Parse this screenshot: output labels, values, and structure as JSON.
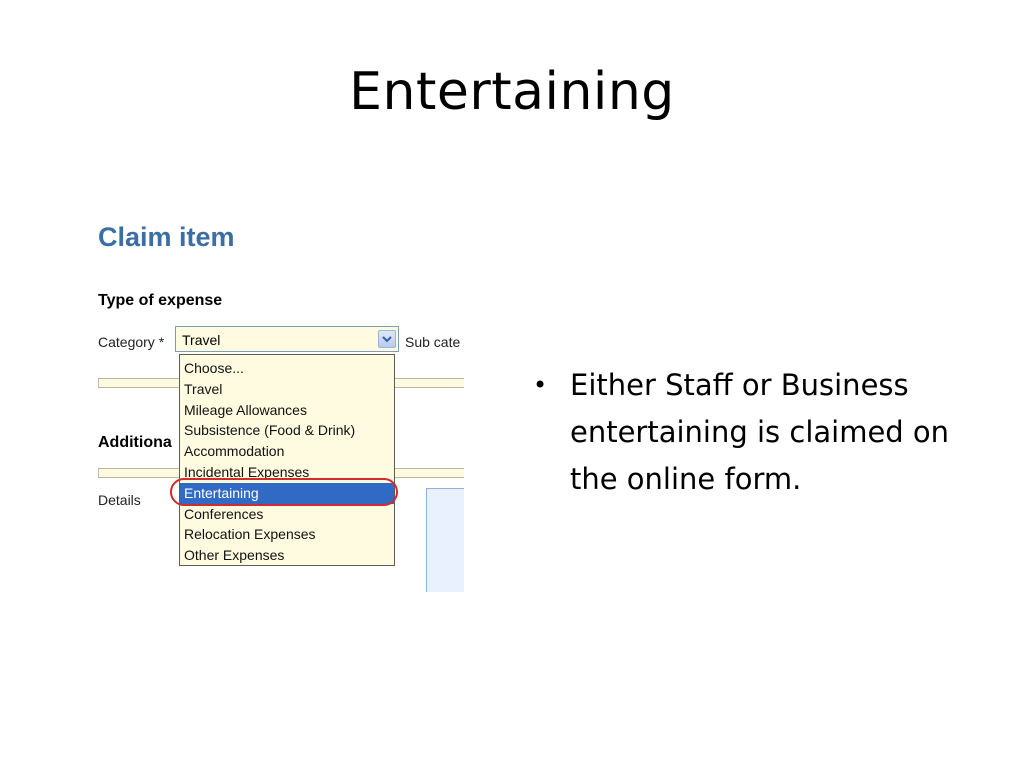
{
  "slide": {
    "title": "Entertaining",
    "bullet": "Either Staff or Business entertaining is claimed on the online form."
  },
  "form": {
    "heading": "Claim item",
    "type_section": "Type of expense",
    "category_label": "Category *",
    "category_value": "Travel",
    "subcategory_label": "Sub cate",
    "additional_section": "Additiona",
    "details_label": "Details",
    "options": [
      "Choose...",
      "Travel",
      "Mileage Allowances",
      "Subsistence (Food & Drink)",
      "Accommodation",
      "Incidental Expenses",
      "Entertaining",
      "Conferences",
      "Relocation Expenses",
      "Other Expenses"
    ],
    "selected_option": "Entertaining"
  },
  "colors": {
    "heading": "#3a6ea5",
    "field_bg": "#fffbe0",
    "selection": "#316ac5",
    "highlight_ring": "#d22b2b"
  }
}
